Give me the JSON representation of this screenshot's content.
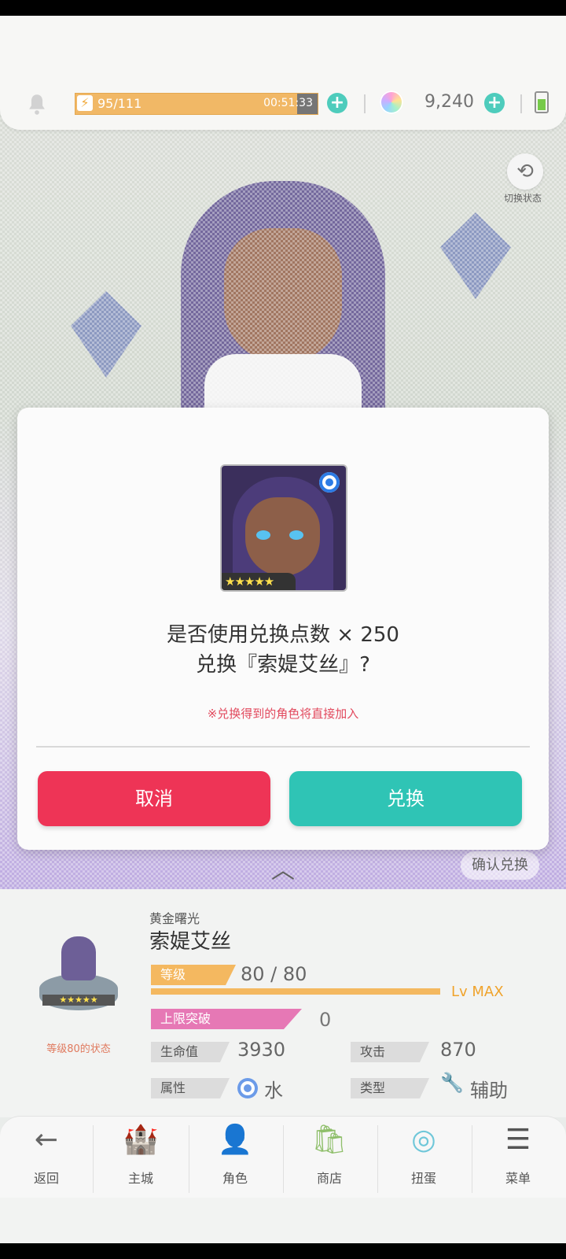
{
  "topbar": {
    "stamina": "95/111",
    "timer": "00:51:33",
    "gems": "9,240"
  },
  "switch_label": "切换状态",
  "dialog": {
    "question_line1": "是否使用兑换点数 × 250",
    "question_line2": "兑换『索媞艾丝』?",
    "note": "※兑换得到的角色将直接加入",
    "cancel_label": "取消",
    "confirm_label": "兑换",
    "stars": "★★★★★"
  },
  "confirm_ghost_label": "确认兑换",
  "character": {
    "subtitle": "黄金曙光",
    "name": "索媞艾丝",
    "level_state": "等级80的状态",
    "level_tag": "等级",
    "level": "80 / 80",
    "lv_max": "Lv MAX",
    "break_tag": "上限突破",
    "break_value": "0",
    "hp_tag": "生命值",
    "hp": "3930",
    "atk_tag": "攻击",
    "atk": "870",
    "attr_tag": "属性",
    "attr": "水",
    "type_tag": "类型",
    "type": "辅助",
    "sprite_stars": "★★★★★"
  },
  "nav": [
    {
      "label": "返回",
      "icon": "back-arrow-icon"
    },
    {
      "label": "主城",
      "icon": "castle-icon"
    },
    {
      "label": "角色",
      "icon": "character-icon"
    },
    {
      "label": "商店",
      "icon": "shop-icon"
    },
    {
      "label": "扭蛋",
      "icon": "gacha-icon"
    },
    {
      "label": "菜单",
      "icon": "menu-icon"
    }
  ],
  "colors": {
    "cancel": "#ee3456",
    "confirm": "#2fc4b5",
    "stamina": "#f0b25a",
    "note": "#e24a5e"
  }
}
